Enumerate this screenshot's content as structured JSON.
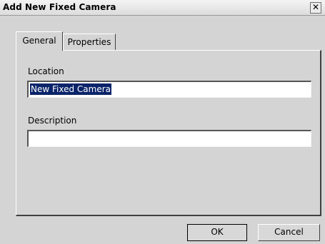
{
  "window": {
    "title": "Add New Fixed Camera",
    "close_glyph": "✕"
  },
  "tabs": [
    {
      "label": "General",
      "active": true
    },
    {
      "label": "Properties",
      "active": false
    }
  ],
  "form": {
    "location_label": "Location",
    "location_value": "New Fixed Camera",
    "description_label": "Description",
    "description_value": ""
  },
  "buttons": {
    "ok": "OK",
    "cancel": "Cancel"
  }
}
